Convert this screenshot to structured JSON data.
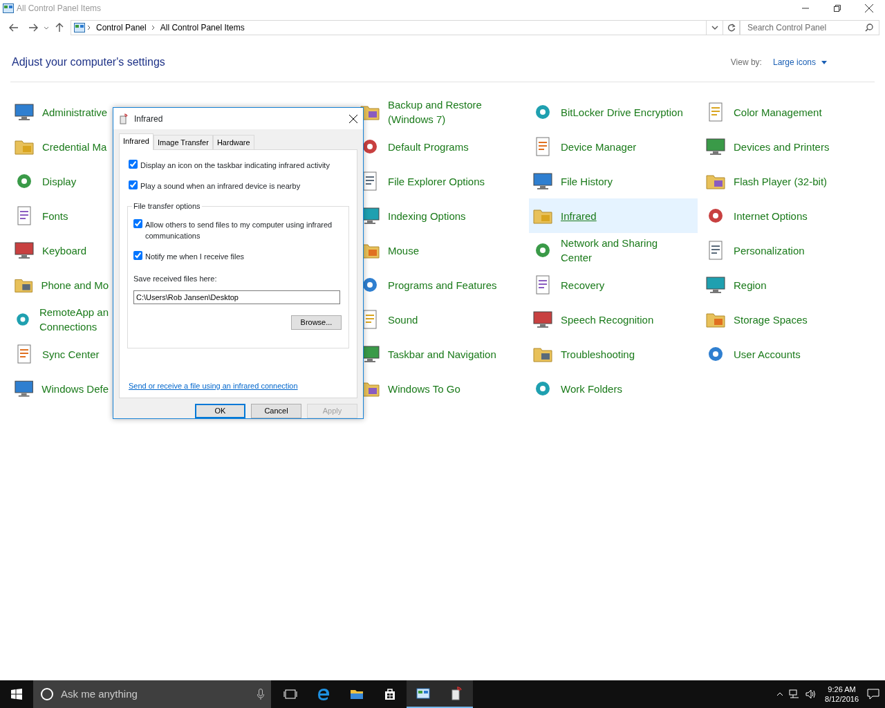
{
  "window": {
    "title": "All Control Panel Items"
  },
  "address": {
    "crumbs": [
      "Control Panel",
      "All Control Panel Items"
    ]
  },
  "search": {
    "placeholder": "Search Control Panel"
  },
  "heading": "Adjust your computer's settings",
  "view_by": {
    "label": "View by:",
    "value": "Large icons"
  },
  "columns": [
    {
      "items": [
        {
          "label": "Administrative",
          "selected": false
        },
        {
          "label": "Credential Ma",
          "selected": false
        },
        {
          "label": "Display",
          "selected": false
        },
        {
          "label": "Fonts",
          "selected": false
        },
        {
          "label": "Keyboard",
          "selected": false
        },
        {
          "label": "Phone and Mo",
          "selected": false
        },
        {
          "label": "RemoteApp an\nConnections",
          "selected": false
        },
        {
          "label": "Sync Center",
          "selected": false
        },
        {
          "label": "Windows Defe",
          "selected": false
        }
      ]
    },
    {
      "items": [
        {
          "label": "Backup and Restore\n(Windows 7)",
          "selected": false
        },
        {
          "label": "Default Programs",
          "selected": false
        },
        {
          "label": "File Explorer Options",
          "selected": false
        },
        {
          "label": "Indexing Options",
          "selected": false
        },
        {
          "label": "Mouse",
          "selected": false
        },
        {
          "label": "Programs and Features",
          "selected": false
        },
        {
          "label": "Sound",
          "selected": false
        },
        {
          "label": "Taskbar and Navigation",
          "selected": false
        },
        {
          "label": "Windows To Go",
          "selected": false
        }
      ]
    },
    {
      "items": [
        {
          "label": "BitLocker Drive Encryption",
          "selected": false
        },
        {
          "label": "Device Manager",
          "selected": false
        },
        {
          "label": "File History",
          "selected": false
        },
        {
          "label": "Infrared",
          "selected": true
        },
        {
          "label": "Network and Sharing\nCenter",
          "selected": false
        },
        {
          "label": "Recovery",
          "selected": false
        },
        {
          "label": "Speech Recognition",
          "selected": false
        },
        {
          "label": "Troubleshooting",
          "selected": false
        },
        {
          "label": "Work Folders",
          "selected": false
        }
      ]
    },
    {
      "items": [
        {
          "label": "Color Management",
          "selected": false
        },
        {
          "label": "Devices and Printers",
          "selected": false
        },
        {
          "label": "Flash Player (32-bit)",
          "selected": false
        },
        {
          "label": "Internet Options",
          "selected": false
        },
        {
          "label": "Personalization",
          "selected": false
        },
        {
          "label": "Region",
          "selected": false
        },
        {
          "label": "Storage Spaces",
          "selected": false
        },
        {
          "label": "User Accounts",
          "selected": false
        }
      ]
    }
  ],
  "dialog": {
    "title": "Infrared",
    "tabs": [
      {
        "label": "Infrared",
        "selected": true
      },
      {
        "label": "Image Transfer",
        "selected": false
      },
      {
        "label": "Hardware",
        "selected": false
      }
    ],
    "options": [
      {
        "label": "Display an icon on the taskbar indicating infrared activity",
        "checked": true
      },
      {
        "label": "Play a sound when an infrared device is nearby",
        "checked": true
      }
    ],
    "group": {
      "title": "File transfer options",
      "options": [
        {
          "label": "Allow others to send files to my computer using infrared communications",
          "checked": true
        },
        {
          "label": "Notify me when I receive files",
          "checked": true
        }
      ],
      "save_label": "Save received files here:",
      "path": "C:\\Users\\Rob Jansen\\Desktop",
      "browse": "Browse..."
    },
    "link": "Send or receive a file using an infrared connection",
    "buttons": [
      {
        "label": "OK",
        "disabled": false
      },
      {
        "label": "Cancel",
        "disabled": false
      },
      {
        "label": "Apply",
        "disabled": true
      }
    ]
  },
  "taskbar": {
    "search_placeholder": "Ask me anything",
    "apps": [
      {
        "kind": "taskview",
        "active": false
      },
      {
        "kind": "edge",
        "active": false
      },
      {
        "kind": "explorer",
        "active": false
      },
      {
        "kind": "store",
        "active": false
      },
      {
        "kind": "controlpanel",
        "active": true
      },
      {
        "kind": "infrared",
        "active": true
      }
    ],
    "time": "9:26 AM",
    "date": "8/12/2016"
  }
}
